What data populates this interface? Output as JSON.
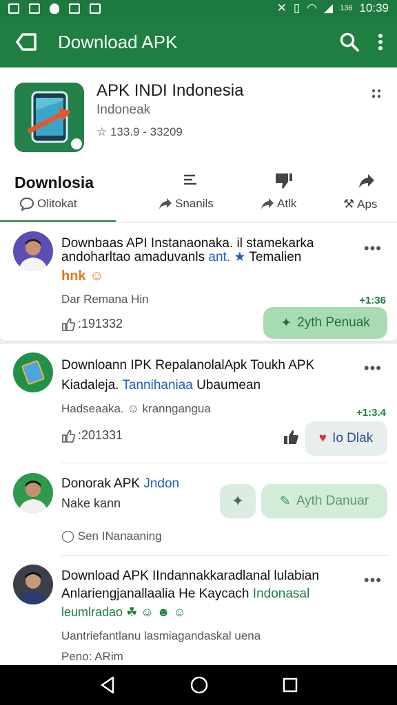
{
  "status_bar": {
    "battery_text": "136",
    "time": "10:39"
  },
  "app_bar": {
    "title": "Download APK",
    "back_icon": "back-icon",
    "search_icon": "search-icon",
    "more_icon": "more-vert-icon"
  },
  "app": {
    "name": "APK INDI Indonesia",
    "developer": "Indoneak",
    "rating": "☆ 133.9 - 33209"
  },
  "tabs": {
    "heading": "Downlosia",
    "items": [
      {
        "label": "Olitokat"
      },
      {
        "label": "Snanils"
      },
      {
        "label": "Atlk"
      },
      {
        "label": "Aps"
      }
    ]
  },
  "posts": [
    {
      "title_line1": "Downbaas API Instanaonaka. il stamekarka",
      "title_line2_a": "andoharltao amaduvanls ",
      "title_line2_b": "ant. ★",
      "title_line2_c": " Temalien",
      "tag": "hnk",
      "meta": "Dar Remana Hin",
      "time": "+1:36",
      "likes": ":191332",
      "action": "2yth Penuak"
    },
    {
      "title_line1": "Downloann IPK RepalanolalApk Toukh APK",
      "title_line2_a": "Kiadaleja. ",
      "title_line2_b": "Tannihaniaa",
      "title_line2_c": " Ubaumean",
      "meta": "Hadseaaka. ☺ kranngangua",
      "time": "+1:3.4",
      "likes": ":201331",
      "action": "Io Dlak"
    },
    {
      "title_a": "Donorak APK ",
      "title_b": "Jndon",
      "sub": "Nake kann",
      "action": "Ayth Danuar",
      "meta": "Sen INanaaning"
    },
    {
      "title_line1": "Download APK IIndannakkaradlanal lulabian",
      "title_line2_a": "Anlariengjanallaalia He Kaycach ",
      "title_line2_b": "Indonasal",
      "tag": "leumlradao",
      "meta": "Uantriefantlanu lasmiagandaskal uena",
      "meta2": "Peno: ARim"
    }
  ],
  "colors": {
    "primary": "#1e7f40",
    "accent_green": "#a9dbb3",
    "link_blue": "#1f5cc2"
  }
}
